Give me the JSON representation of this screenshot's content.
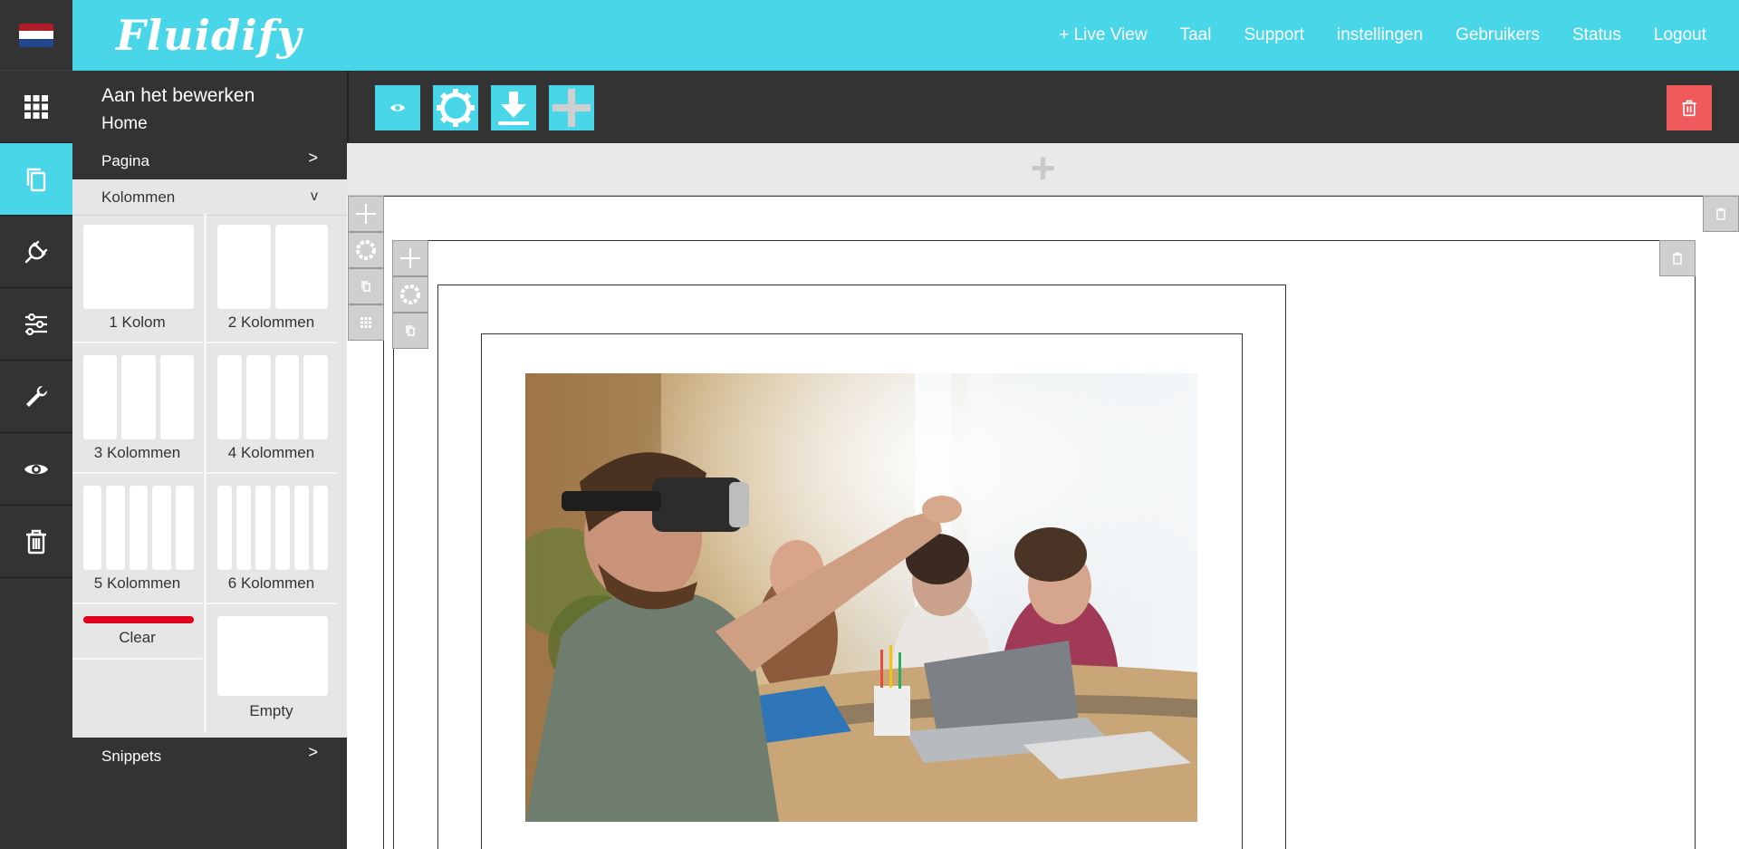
{
  "brand": {
    "logo_text": "Fluidify",
    "accent": "#49d6e8",
    "dark": "#333333",
    "danger": "#f05a5a"
  },
  "flag": {
    "colors": [
      "#ae1c28",
      "#ffffff",
      "#21468b"
    ]
  },
  "rail": {
    "items": [
      {
        "icon": "grid-icon"
      },
      {
        "icon": "copy-pages-icon",
        "active": true
      },
      {
        "icon": "plug-icon"
      },
      {
        "icon": "sliders-icon"
      },
      {
        "icon": "wrench-icon"
      },
      {
        "icon": "eye-icon"
      },
      {
        "icon": "trash-icon"
      }
    ]
  },
  "topnav": {
    "items": [
      "+ Live View",
      "Taal",
      "Support",
      "instellingen",
      "Gebruikers",
      "Status",
      "Logout"
    ]
  },
  "panel": {
    "editing_label": "Aan het bewerken",
    "editing_page": "Home",
    "sections": {
      "pagina": {
        "label": "Pagina",
        "arrow": ">"
      },
      "kolommen": {
        "label": "Kolommen",
        "arrow": "v"
      },
      "snippets": {
        "label": "Snippets",
        "arrow": ">"
      }
    },
    "layouts": [
      {
        "label": "1 Kolom",
        "cols": 1
      },
      {
        "label": "2 Kolommen",
        "cols": 2
      },
      {
        "label": "3 Kolommen",
        "cols": 3
      },
      {
        "label": "4 Kolommen",
        "cols": 4
      },
      {
        "label": "5 Kolommen",
        "cols": 5
      },
      {
        "label": "6 Kolommen",
        "cols": 6
      }
    ],
    "clear_label": "Clear",
    "empty_label": "Empty"
  },
  "toolbar": {
    "buttons": [
      "preview-eye-icon",
      "settings-gear-icon",
      "download-icon",
      "add-plus-icon"
    ],
    "delete_icon": "trash-icon"
  },
  "canvas": {
    "add_row_symbol": "+",
    "image_alt": "Man met VR-bril in vergaderruimte"
  }
}
